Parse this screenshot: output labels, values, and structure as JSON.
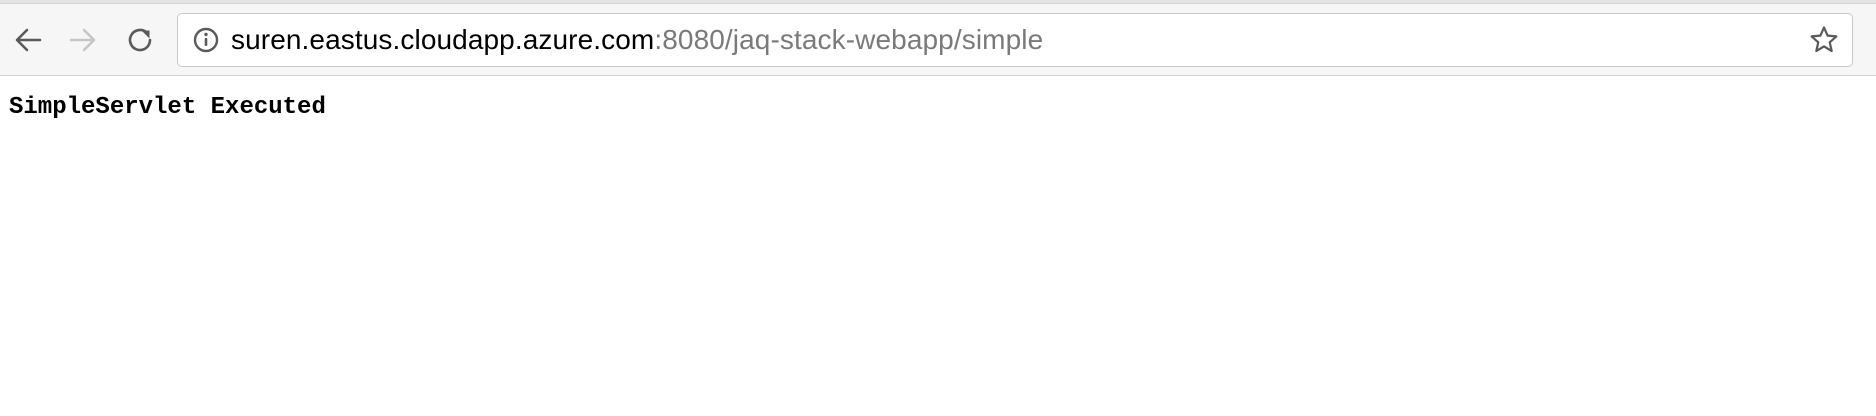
{
  "toolbar": {
    "back_icon": "arrow-left-icon",
    "forward_icon": "arrow-right-icon",
    "forward_enabled": false,
    "reload_icon": "reload-icon"
  },
  "address_bar": {
    "security_icon": "info-circle-icon",
    "url_host": "suren.eastus.cloudapp.azure.com",
    "url_rest": ":8080/jaq-stack-webapp/simple",
    "bookmark_icon": "star-outline-icon"
  },
  "page": {
    "body_text": "SimpleServlet Executed"
  },
  "colors": {
    "toolbar_bg": "#f6f6f6",
    "url_host": "#000000",
    "url_path": "#7a7a7a",
    "icon_active": "#5a5a5a",
    "icon_disabled": "#c6c6c6"
  }
}
